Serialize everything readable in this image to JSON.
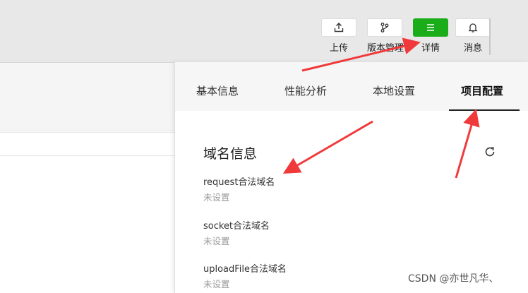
{
  "toolbar": {
    "buttons": [
      {
        "label": "上传",
        "icon": "upload-icon"
      },
      {
        "label": "版本管理",
        "icon": "branch-icon"
      },
      {
        "label": "详情",
        "icon": "list-icon",
        "active": true
      },
      {
        "label": "消息",
        "icon": "bell-icon"
      }
    ]
  },
  "panel": {
    "tabs": [
      "基本信息",
      "性能分析",
      "本地设置",
      "项目配置"
    ],
    "active_tab": "项目配置",
    "section_title": "域名信息",
    "items": [
      {
        "label": "request合法域名",
        "value": "未设置"
      },
      {
        "label": "socket合法域名",
        "value": "未设置"
      },
      {
        "label": "uploadFile合法域名",
        "value": "未设置"
      }
    ]
  },
  "watermark": "CSDN @亦世凡华、",
  "colors": {
    "accent": "#1aad19",
    "arrow": "#f0393a"
  }
}
